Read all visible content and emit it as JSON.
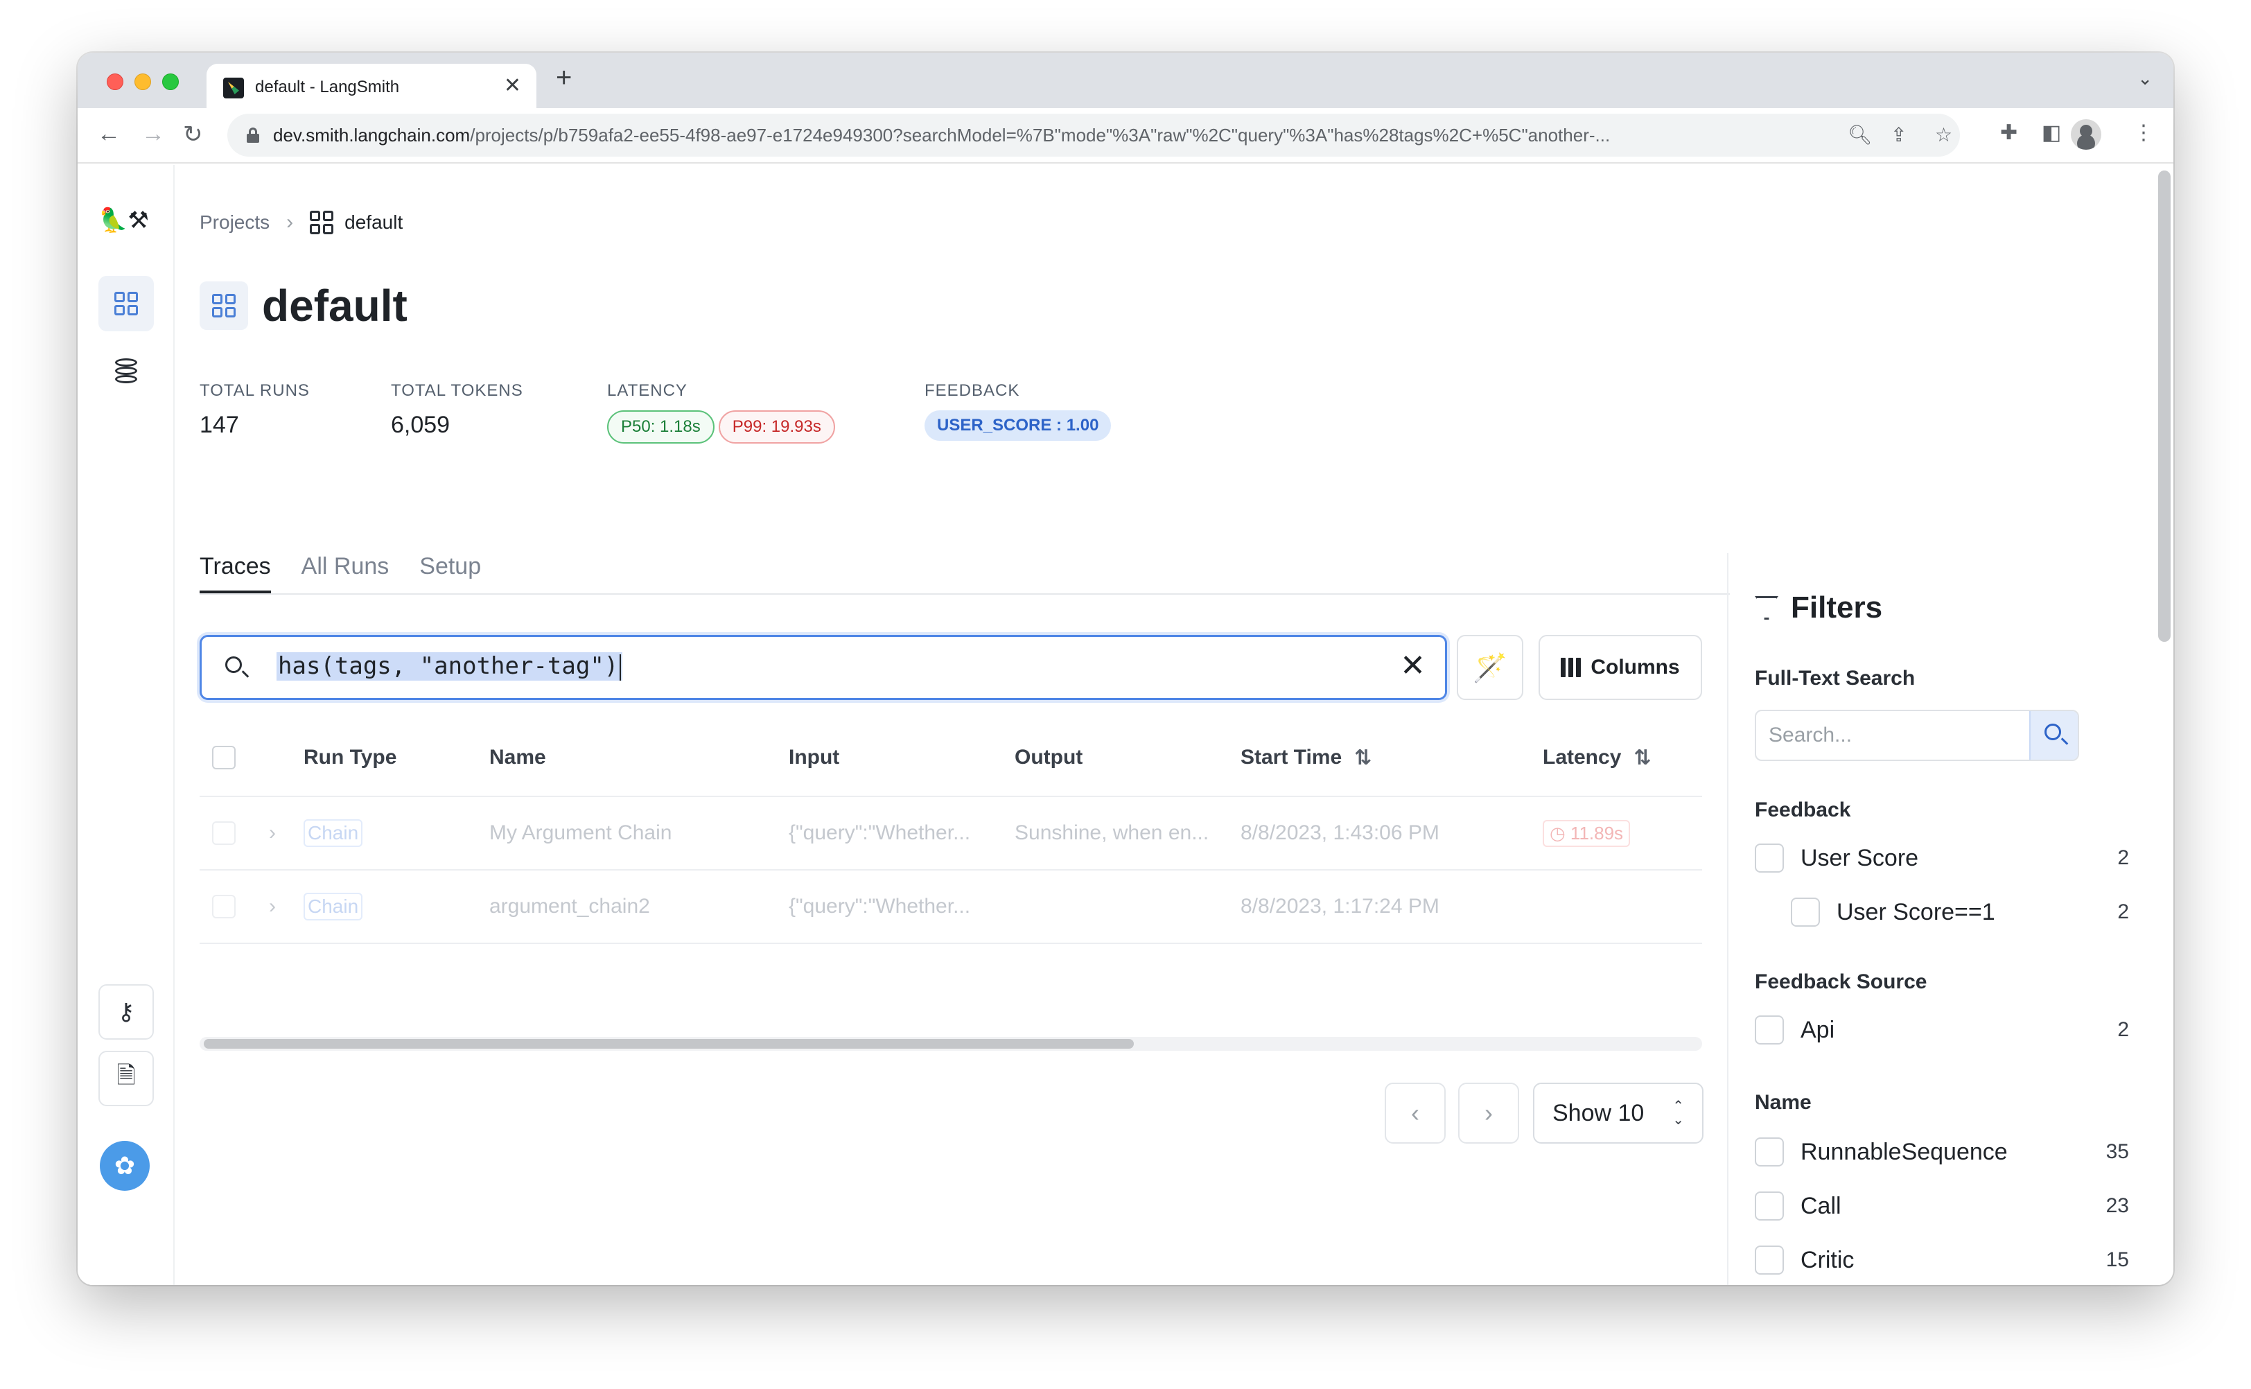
{
  "browser": {
    "tab_title": "default - LangSmith",
    "tab_close": "✕",
    "new_tab": "+",
    "url_host": "dev.smith.langchain.com",
    "url_path": "/projects/p/b759afa2-ee55-4f98-ae97-e1724e949300?searchModel=%7B\"mode\"%3A\"raw\"%2C\"query\"%3A\"has%28tags%2C+%5C\"another-...",
    "nav_back": "←",
    "nav_forward": "→",
    "nav_reload": "↻"
  },
  "sidebar": {
    "logo": "🦜⚒",
    "items": [
      {
        "name": "projects",
        "icon": "grid-icon",
        "active": true
      },
      {
        "name": "datasets",
        "icon": "database-icon",
        "active": false
      },
      {
        "name": "api-keys",
        "icon": "key-icon",
        "active": false
      },
      {
        "name": "docs",
        "icon": "document-icon",
        "active": false
      },
      {
        "name": "organization",
        "icon": "team-avatar-icon",
        "active": false
      }
    ]
  },
  "breadcrumb": {
    "root": "Projects",
    "separator": "›",
    "current": "default"
  },
  "page": {
    "title": "default"
  },
  "stats": {
    "total_runs_label": "TOTAL RUNS",
    "total_runs": "147",
    "total_tokens_label": "TOTAL TOKENS",
    "total_tokens": "6,059",
    "latency_label": "LATENCY",
    "p50": "P50: 1.18s",
    "p99": "P99: 19.93s",
    "feedback_label": "FEEDBACK",
    "feedback": "USER_SCORE : 1.00"
  },
  "tabs": [
    {
      "label": "Traces",
      "active": true
    },
    {
      "label": "All Runs",
      "active": false
    },
    {
      "label": "Setup",
      "active": false
    }
  ],
  "search": {
    "query": "has(tags, \"another-tag\")",
    "clear": "✕"
  },
  "toolbar": {
    "columns_label": "Columns",
    "magic_icon": "🪄"
  },
  "table": {
    "headers": {
      "run_type": "Run Type",
      "name": "Name",
      "input": "Input",
      "output": "Output",
      "start_time": "Start Time",
      "latency": "Latency"
    },
    "sort_icon": "⇅",
    "rows": [
      {
        "run_type": "Chain",
        "name": "My Argument Chain",
        "input": "{\"query\":\"Whether...",
        "output": "Sunshine, when en...",
        "start_time": "8/8/2023, 1:43:06 PM",
        "latency": "◷ 11.89s"
      },
      {
        "run_type": "Chain",
        "name": "argument_chain2",
        "input": "{\"query\":\"Whether...",
        "output": "",
        "start_time": "8/8/2023, 1:17:24 PM",
        "latency": ""
      }
    ],
    "expand_icon": "›"
  },
  "pagination": {
    "prev": "‹",
    "next": "›",
    "show_label": "Show 10",
    "show_arrows_up": "⌃",
    "show_arrows_down": "⌄"
  },
  "filters": {
    "title": "Filters",
    "full_text_label": "Full-Text Search",
    "search_placeholder": "Search...",
    "sections": {
      "feedback": "Feedback",
      "feedback_source": "Feedback Source",
      "name": "Name"
    },
    "feedback_items": [
      {
        "label": "User Score",
        "count": "2"
      },
      {
        "label": "User Score==1",
        "count": "2"
      }
    ],
    "feedback_source_items": [
      {
        "label": "Api",
        "count": "2"
      }
    ],
    "name_items": [
      {
        "label": "RunnableSequence",
        "count": "35"
      },
      {
        "label": "Call",
        "count": "23"
      },
      {
        "label": "Critic",
        "count": "15"
      }
    ]
  }
}
